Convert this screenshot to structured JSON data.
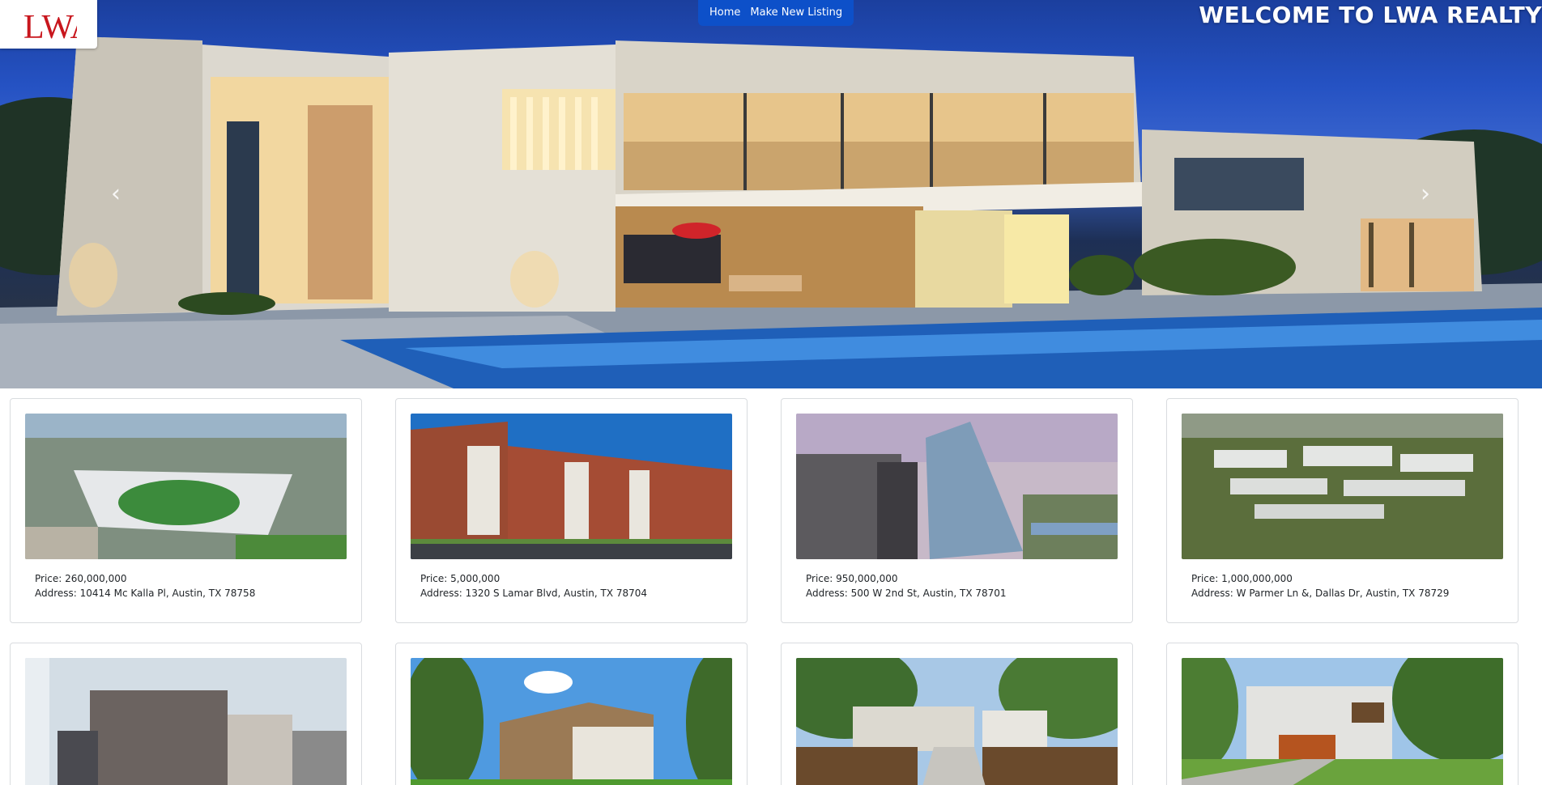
{
  "header": {
    "logo_text": "LWA",
    "nav": [
      {
        "label": "Home"
      },
      {
        "label": "Make New Listing"
      }
    ],
    "welcome": "WELCOME TO LWA REALTY"
  },
  "carousel": {
    "prev_icon": "chevron-left-icon",
    "next_icon": "chevron-right-icon"
  },
  "listings": [
    {
      "price_label": "Price: 260,000,000",
      "address_label": "Address: 10414 Mc Kalla Pl, Austin, TX 78758"
    },
    {
      "price_label": "Price: 5,000,000",
      "address_label": "Address: 1320 S Lamar Blvd, Austin, TX 78704"
    },
    {
      "price_label": "Price: 950,000,000",
      "address_label": "Address: 500 W 2nd St, Austin, TX 78701"
    },
    {
      "price_label": "Price: 1,000,000,000",
      "address_label": "Address: W Parmer Ln &, Dallas Dr, Austin, TX 78729"
    },
    {
      "price_label": "",
      "address_label": ""
    },
    {
      "price_label": "",
      "address_label": ""
    },
    {
      "price_label": "",
      "address_label": ""
    },
    {
      "price_label": "",
      "address_label": ""
    }
  ],
  "colors": {
    "nav_bg": "#0d50c9",
    "logo_red": "#c8161d",
    "card_border": "#d9dcdf"
  }
}
